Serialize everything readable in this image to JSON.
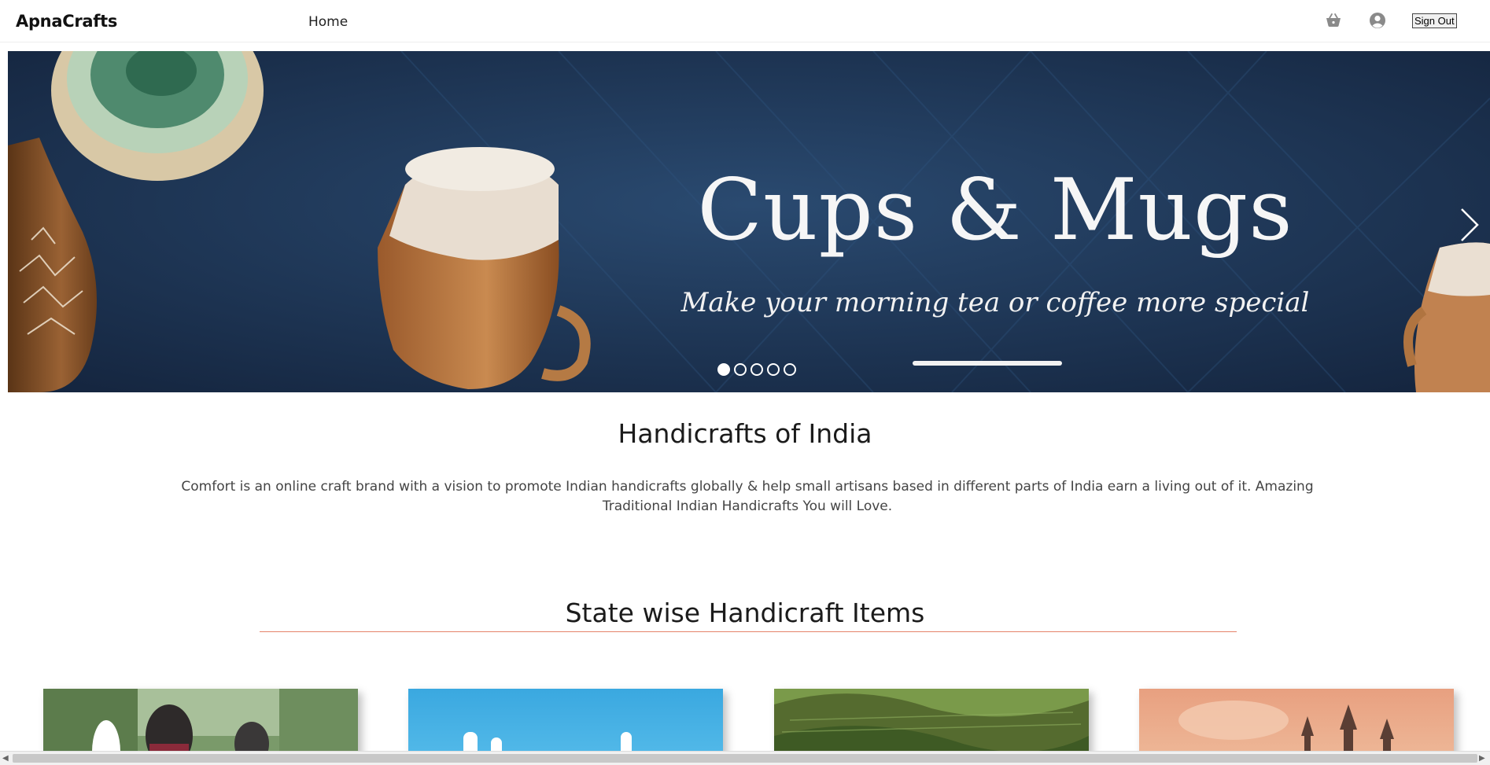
{
  "navbar": {
    "brand": "ApnaCrafts",
    "links": [
      {
        "label": "Home"
      }
    ],
    "cart_icon": "basket-icon",
    "user_icon": "user-circle-icon",
    "signout_label": "Sign Out"
  },
  "hero": {
    "title": "Cups & Mugs",
    "subtitle": "Make your morning tea or coffee more special",
    "slide_count": 5,
    "active_slide": 1,
    "next_icon": "chevron-right-icon",
    "colors": {
      "background": "#1e3350",
      "text": "#f6f6f6"
    }
  },
  "intro": {
    "title": "Handicrafts of India",
    "text": "Comfort is an online craft brand with a vision to promote Indian handicrafts globally & help small artisans based in different parts of India earn a living out of it. Amazing Traditional Indian Handicrafts You will Love."
  },
  "states": {
    "title": "State wise Handicraft Items",
    "rule_color": "#e5836a",
    "cards": [
      {
        "image": "people-in-forest-photo"
      },
      {
        "image": "blue-sky-photo"
      },
      {
        "image": "green-hills-photo"
      },
      {
        "image": "palace-sunset-photo"
      }
    ]
  }
}
